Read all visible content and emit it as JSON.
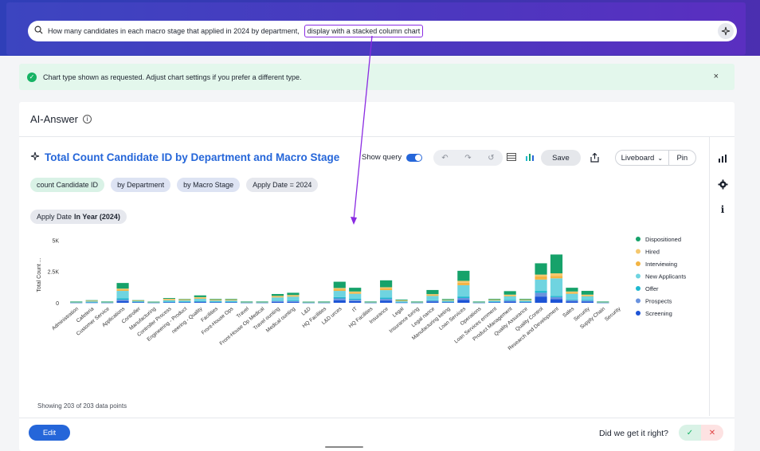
{
  "search": {
    "query_main": "How many candidates in each macro stage that applied in 2024 by department,",
    "query_highlight": "display with a stacked column chart"
  },
  "banner": {
    "message": "Chart type shown as requested. Adjust chart settings if you prefer a different type.",
    "close_label": "×"
  },
  "answer": {
    "title": "AI-Answer",
    "info_label": "i"
  },
  "chart_header": {
    "title": "Total Count Candidate ID by Department and Macro Stage",
    "show_query_label": "Show query",
    "save_label": "Save",
    "liveboard_label": "Liveboard",
    "pin_label": "Pin"
  },
  "chips": [
    "count Candidate ID",
    "by Department",
    "by Macro Stage",
    "Apply Date = 2024"
  ],
  "filter": {
    "label": "Apply Date",
    "value": "In Year (2024)"
  },
  "footer": {
    "showing": "Showing 203 of 203 data points",
    "edit_label": "Edit",
    "feedback_question": "Did we get it right?"
  },
  "colors": {
    "Dispositioned": "#16a26a",
    "Hired": "#f5c86e",
    "Interviewing": "#f3b443",
    "New Applicants": "#6fd4e0",
    "Offer": "#1fb8d0",
    "Prospects": "#6a93df",
    "Screening": "#1d54d6"
  },
  "chart_data": {
    "type": "bar",
    "stacked": true,
    "ylabel": "Total Count ...",
    "yticks": [
      "0",
      "2.5K",
      "5K"
    ],
    "ylim": [
      0,
      5400
    ],
    "legend_position": "right",
    "categories": [
      "Administration",
      "Cafeteria",
      "Customer Service",
      "Applications",
      "Controller",
      "Manufacturing",
      "Controller Process",
      "Engineering - Product",
      "Engineering - Quality",
      "Facilities",
      "Front-House Ops",
      "Travel",
      "Front-House Op Medical",
      "Travel Accounting",
      "Medical Accounting",
      "L&D",
      "HQ Facilities",
      "L&D Resources",
      "IT",
      "HQ Facilities",
      "Insurance",
      "Legal",
      "Insurance Tuning",
      "Legal Finance",
      "Manufacturing Marketing",
      "Loan Services",
      "Operations",
      "Loan Services Government",
      "Product Management",
      "Quality Assurance",
      "Quality Control",
      "Research and Development",
      "Sales",
      "Security",
      "Supply Chain",
      "Security"
    ],
    "category_labels": [
      "Administration",
      "Cafeteria",
      "Customer Service",
      "Applications",
      "Controller",
      "Manufacturing",
      "Controller Process",
      "Engineering - Product",
      "neering - Quality",
      "Facilities",
      "Front-House Ops",
      "Travel",
      "Front-House Op Medical",
      "Travel ounting",
      "Medical ounting",
      "L&D",
      "HQ Facilities",
      "L&D urces",
      "IT",
      "HQ Facilities",
      "Insurance",
      "Legal",
      "Insurance turing",
      "Legal nance",
      "Manufacturing keting",
      "Loan Services",
      "Operations",
      "Loan Services ernment",
      "Product Management",
      "Quality Assurance",
      "Quality Control",
      "Research and Development",
      "Sales",
      "Security",
      "Supply Chain",
      "Security"
    ],
    "series": [
      {
        "name": "Screening",
        "values": [
          15,
          20,
          15,
          150,
          40,
          10,
          40,
          40,
          60,
          40,
          40,
          10,
          10,
          80,
          80,
          10,
          10,
          200,
          140,
          10,
          180,
          20,
          10,
          100,
          40,
          230,
          10,
          40,
          100,
          40,
          500,
          300,
          120,
          100,
          10
        ]
      },
      {
        "name": "Prospects",
        "values": [
          10,
          20,
          10,
          100,
          30,
          10,
          30,
          30,
          40,
          30,
          30,
          10,
          10,
          60,
          60,
          10,
          10,
          150,
          100,
          10,
          130,
          20,
          10,
          60,
          30,
          150,
          10,
          30,
          70,
          30,
          300,
          150,
          90,
          70,
          10
        ]
      },
      {
        "name": "Offer",
        "values": [
          10,
          20,
          10,
          100,
          20,
          10,
          20,
          20,
          30,
          20,
          20,
          10,
          10,
          40,
          50,
          10,
          10,
          100,
          80,
          10,
          100,
          20,
          10,
          40,
          20,
          120,
          10,
          20,
          50,
          20,
          150,
          100,
          60,
          50,
          10
        ]
      },
      {
        "name": "New Applicants",
        "values": [
          40,
          60,
          40,
          600,
          60,
          30,
          120,
          100,
          200,
          100,
          100,
          40,
          40,
          250,
          300,
          30,
          40,
          500,
          400,
          40,
          600,
          80,
          40,
          350,
          100,
          900,
          40,
          100,
          300,
          100,
          900,
          1400,
          450,
          300,
          40
        ]
      },
      {
        "name": "Interviewing",
        "values": [
          10,
          30,
          10,
          100,
          20,
          10,
          50,
          40,
          60,
          30,
          30,
          10,
          10,
          60,
          70,
          10,
          10,
          150,
          100,
          10,
          150,
          30,
          10,
          80,
          20,
          200,
          10,
          30,
          70,
          30,
          250,
          200,
          100,
          70,
          10
        ]
      },
      {
        "name": "Hired",
        "values": [
          5,
          20,
          5,
          80,
          10,
          5,
          60,
          40,
          60,
          40,
          40,
          5,
          5,
          60,
          60,
          5,
          5,
          80,
          80,
          5,
          80,
          30,
          5,
          60,
          20,
          150,
          5,
          30,
          60,
          30,
          150,
          200,
          80,
          60,
          5
        ]
      },
      {
        "name": "Dispositioned",
        "values": [
          10,
          40,
          10,
          450,
          30,
          15,
          60,
          40,
          140,
          50,
          50,
          15,
          15,
          150,
          180,
          15,
          15,
          500,
          300,
          15,
          550,
          60,
          15,
          330,
          70,
          800,
          15,
          60,
          280,
          60,
          900,
          1500,
          300,
          300,
          15
        ]
      }
    ]
  }
}
